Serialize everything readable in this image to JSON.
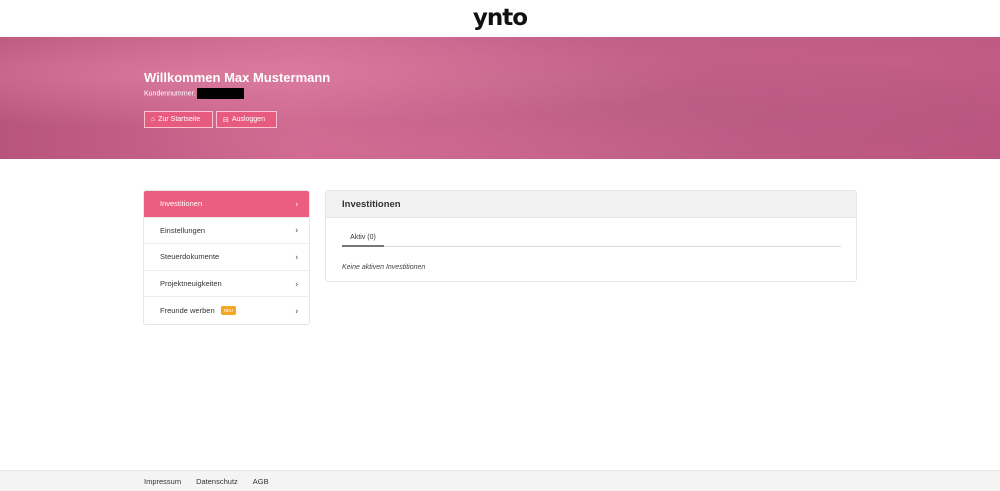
{
  "header": {
    "logo": "ynto"
  },
  "hero": {
    "welcome": "Willkommen Max Mustermann",
    "customer_label": "Kundennummer:",
    "buttons": [
      {
        "icon": "home-icon",
        "label": "Zur Startseite"
      },
      {
        "icon": "logout-icon",
        "label": "Ausloggen"
      }
    ]
  },
  "sidebar": {
    "items": [
      {
        "label": "Investitionen",
        "active": true
      },
      {
        "label": "Einstellungen"
      },
      {
        "label": "Steuerdokumente"
      },
      {
        "label": "Projektneuigkeiten"
      },
      {
        "label": "Freunde werben",
        "badge": "NEU"
      }
    ]
  },
  "panel": {
    "title": "Investitionen",
    "tabs": [
      {
        "label": "Aktiv (0)",
        "active": true
      }
    ],
    "empty_text": "Keine aktiven Investitionen"
  },
  "footer": {
    "links": [
      "Impressum",
      "Datenschutz",
      "AGB"
    ]
  },
  "colors": {
    "accent": "#ec5e7f",
    "badge": "#f5a623"
  }
}
